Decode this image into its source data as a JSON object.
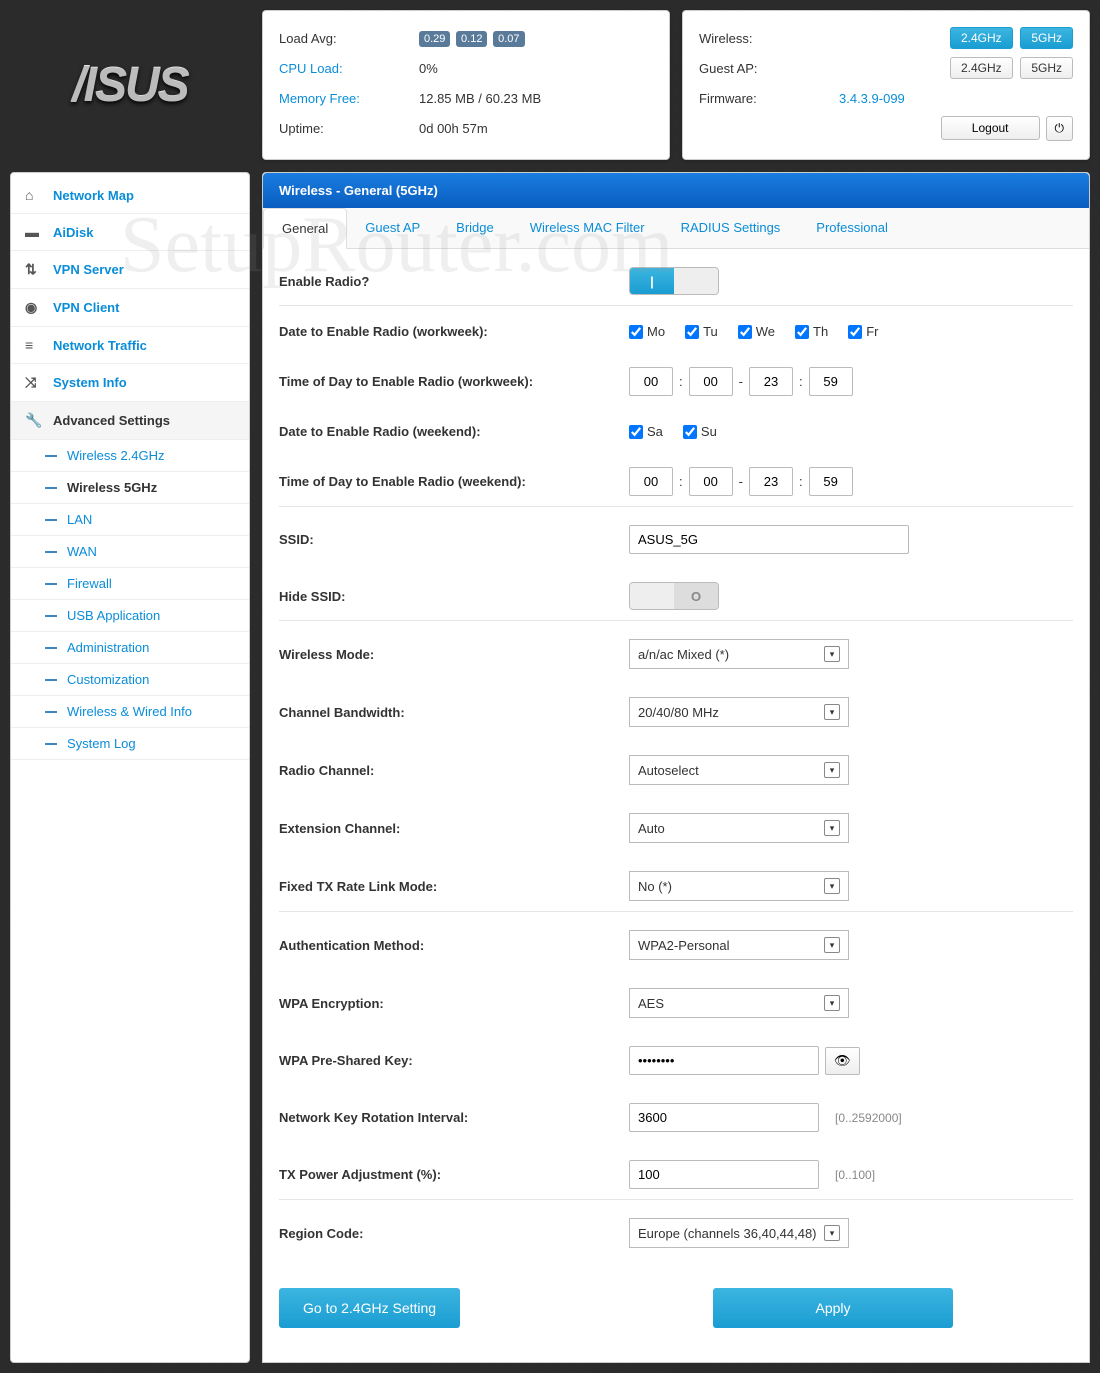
{
  "watermark": "SetupRouter.com",
  "status1": {
    "load_label": "Load Avg:",
    "load_vals": [
      "0.29",
      "0.12",
      "0.07"
    ],
    "cpu_label": "CPU Load:",
    "cpu_val": "0%",
    "mem_label": "Memory Free:",
    "mem_val": "12.85 MB / 60.23 MB",
    "uptime_label": "Uptime:",
    "uptime_val": "0d 00h 57m"
  },
  "status2": {
    "wireless_label": "Wireless:",
    "w24": "2.4GHz",
    "w5": "5GHz",
    "guest_label": "Guest AP:",
    "g24": "2.4GHz",
    "g5": "5GHz",
    "fw_label": "Firmware:",
    "fw_val": "3.4.3.9-099",
    "logout": "Logout"
  },
  "sidebar": {
    "items": [
      {
        "label": "Network Map"
      },
      {
        "label": "AiDisk"
      },
      {
        "label": "VPN Server"
      },
      {
        "label": "VPN Client"
      },
      {
        "label": "Network Traffic"
      },
      {
        "label": "System Info"
      },
      {
        "label": "Advanced Settings"
      }
    ],
    "subs": [
      {
        "label": "Wireless 2.4GHz"
      },
      {
        "label": "Wireless 5GHz"
      },
      {
        "label": "LAN"
      },
      {
        "label": "WAN"
      },
      {
        "label": "Firewall"
      },
      {
        "label": "USB Application"
      },
      {
        "label": "Administration"
      },
      {
        "label": "Customization"
      },
      {
        "label": "Wireless & Wired Info"
      },
      {
        "label": "System Log"
      }
    ]
  },
  "header": "Wireless - General (5GHz)",
  "tabs": [
    "General",
    "Guest AP",
    "Bridge",
    "Wireless MAC Filter",
    "RADIUS Settings",
    "Professional"
  ],
  "form": {
    "enable_radio": "Enable Radio?",
    "date_workweek": "Date to Enable Radio (workweek):",
    "days_ww": [
      "Mo",
      "Tu",
      "We",
      "Th",
      "Fr"
    ],
    "time_workweek": "Time of Day to Enable Radio (workweek):",
    "ww_t1": "00",
    "ww_t2": "00",
    "ww_t3": "23",
    "ww_t4": "59",
    "date_weekend": "Date to Enable Radio (weekend):",
    "days_we": [
      "Sa",
      "Su"
    ],
    "time_weekend": "Time of Day to Enable Radio (weekend):",
    "we_t1": "00",
    "we_t2": "00",
    "we_t3": "23",
    "we_t4": "59",
    "ssid_label": "SSID:",
    "ssid_val": "ASUS_5G",
    "hide_ssid": "Hide SSID:",
    "wmode_label": "Wireless Mode:",
    "wmode_val": "a/n/ac Mixed (*)",
    "bw_label": "Channel Bandwidth:",
    "bw_val": "20/40/80 MHz",
    "rch_label": "Radio Channel:",
    "rch_val": "Autoselect",
    "ech_label": "Extension Channel:",
    "ech_val": "Auto",
    "txrate_label": "Fixed TX Rate Link Mode:",
    "txrate_val": "No (*)",
    "auth_label": "Authentication Method:",
    "auth_val": "WPA2-Personal",
    "enc_label": "WPA Encryption:",
    "enc_val": "AES",
    "psk_label": "WPA Pre-Shared Key:",
    "psk_val": "••••••••",
    "rot_label": "Network Key Rotation Interval:",
    "rot_val": "3600",
    "rot_hint": "[0..2592000]",
    "txp_label": "TX Power Adjustment (%):",
    "txp_val": "100",
    "txp_hint": "[0..100]",
    "reg_label": "Region Code:",
    "reg_val": "Europe (channels 36,40,44,48)",
    "goto24": "Go to 2.4GHz Setting",
    "apply": "Apply"
  }
}
